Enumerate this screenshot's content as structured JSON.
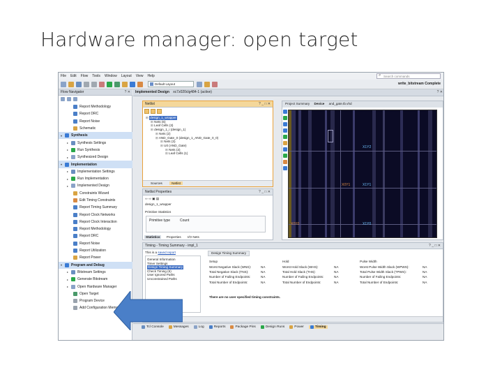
{
  "slide_title": "Hardware manager: open target",
  "menu": [
    "File",
    "Edit",
    "Flow",
    "Tools",
    "Window",
    "Layout",
    "View",
    "Help"
  ],
  "search_placeholder": "Search commands",
  "layout_select": "Default Layout",
  "status": "write_bitstream Complete",
  "flow_nav": {
    "title": "Flow Navigator",
    "items": [
      {
        "label": "Report Methodology",
        "indent": 2,
        "icon": "report-icon",
        "color": "#4a7fc8"
      },
      {
        "label": "Report DRC",
        "indent": 2,
        "icon": "report-icon",
        "color": "#4a7fc8"
      },
      {
        "label": "Report Noise",
        "indent": 2,
        "icon": "report-icon",
        "color": "#4a7fc8"
      },
      {
        "label": "Schematic",
        "indent": 2,
        "icon": "schematic-icon",
        "color": "#d9a443"
      },
      {
        "label": "Synthesis",
        "indent": 0,
        "icon": "synthesis-icon",
        "color": "#3a7bd5",
        "section": true
      },
      {
        "label": "Synthesis Settings",
        "indent": 1,
        "icon": "gear-icon",
        "color": "#6a8fc0"
      },
      {
        "label": "Run Synthesis",
        "indent": 1,
        "icon": "run-icon",
        "color": "#2aa84a"
      },
      {
        "label": "Synthesized Design",
        "indent": 1,
        "icon": "design-icon",
        "color": "#8aa3c8"
      },
      {
        "label": "Implementation",
        "indent": 0,
        "icon": "implementation-icon",
        "color": "#3a7bd5",
        "section": true
      },
      {
        "label": "Implementation Settings",
        "indent": 1,
        "icon": "gear-icon",
        "color": "#6a8fc0"
      },
      {
        "label": "Run Implementation",
        "indent": 1,
        "icon": "run-icon",
        "color": "#2aa84a"
      },
      {
        "label": "Implemented Design",
        "indent": 1,
        "icon": "design-icon",
        "color": "#8aa3c8"
      },
      {
        "label": "Constraints Wizard",
        "indent": 2,
        "icon": "wizard-icon",
        "color": "#d9a443"
      },
      {
        "label": "Edit Timing Constraints",
        "indent": 2,
        "icon": "clock-icon",
        "color": "#d98a43"
      },
      {
        "label": "Report Timing Summary",
        "indent": 2,
        "icon": "clock-icon",
        "color": "#4a7fc8"
      },
      {
        "label": "Report Clock Networks",
        "indent": 2,
        "icon": "report-icon",
        "color": "#4a7fc8"
      },
      {
        "label": "Report Clock Interaction",
        "indent": 2,
        "icon": "report-icon",
        "color": "#4a7fc8"
      },
      {
        "label": "Report Methodology",
        "indent": 2,
        "icon": "report-icon",
        "color": "#4a7fc8"
      },
      {
        "label": "Report DRC",
        "indent": 2,
        "icon": "report-icon",
        "color": "#4a7fc8"
      },
      {
        "label": "Report Noise",
        "indent": 2,
        "icon": "report-icon",
        "color": "#4a7fc8"
      },
      {
        "label": "Report Utilization",
        "indent": 2,
        "icon": "report-icon",
        "color": "#4a7fc8"
      },
      {
        "label": "Report Power",
        "indent": 2,
        "icon": "power-icon",
        "color": "#d9a443"
      },
      {
        "label": "Program and Debug",
        "indent": 0,
        "icon": "program-icon",
        "color": "#3a7bd5",
        "section": true
      },
      {
        "label": "Bitstream Settings",
        "indent": 1,
        "icon": "gear-icon",
        "color": "#6a8fc0"
      },
      {
        "label": "Generate Bitstream",
        "indent": 1,
        "icon": "bitstream-icon",
        "color": "#2aa84a"
      },
      {
        "label": "Open Hardware Manager",
        "indent": 1,
        "icon": "hardware-icon",
        "color": "#8aa3c8"
      },
      {
        "label": "Open Target",
        "indent": 2,
        "icon": "target-icon",
        "color": "#4a9a6a"
      },
      {
        "label": "Program Device",
        "indent": 2,
        "icon": "chip-icon",
        "color": "#9aa3ad"
      },
      {
        "label": "Add Configuration Memory D",
        "indent": 2,
        "icon": "memory-icon",
        "color": "#9aa3ad"
      }
    ]
  },
  "impl_header": {
    "title": "Implemented Design",
    "part": "xc7z020clg484-1",
    "state": "(active)"
  },
  "netlist": {
    "title": "Netlist",
    "tree": [
      {
        "label": "design_1_wrapper",
        "indent": 0,
        "selected": true
      },
      {
        "label": "Nets (6)",
        "indent": 1
      },
      {
        "label": "Leaf Cells (3)",
        "indent": 1
      },
      {
        "label": "design_1_i (design_1)",
        "indent": 1
      },
      {
        "label": "Nets (2)",
        "indent": 2
      },
      {
        "label": "AND_Gate_0 (design_1_AND_Gate_0_0)",
        "indent": 2
      },
      {
        "label": "Nets (3)",
        "indent": 3
      },
      {
        "label": "U0 (AND_Gate)",
        "indent": 3
      },
      {
        "label": "Nets (3)",
        "indent": 4
      },
      {
        "label": "Leaf Cells (1)",
        "indent": 4
      }
    ],
    "tabs": [
      "Sources",
      "Netlist"
    ]
  },
  "netlist_props": {
    "title": "Netlist Properties",
    "object": "design_1_wrapper",
    "section": "Primitive Statistics",
    "col1": "Primitive type",
    "col2": "Count",
    "tabs": [
      "Statistics",
      "Properties",
      "I/O Nets"
    ]
  },
  "device_tabs": [
    "Project Summary",
    "Device",
    "and_gate.tb.vhd"
  ],
  "clock_regions": [
    "X1Y2",
    "X0Y1",
    "X1Y1",
    "X0Y0",
    "X1Y0"
  ],
  "timing": {
    "title": "Timing - Timing Summary - impl_1",
    "saved_note": "This is a",
    "saved_link": "saved report",
    "tree": [
      "General Information",
      "Timer Settings",
      "Design Timing Summary",
      "Check Timing (6)",
      "User Ignored Paths",
      "Unconstrained Paths"
    ],
    "tree_selected": 2,
    "tab": "Design Timing Summary",
    "setup": {
      "title": "Setup",
      "rows": [
        [
          "Worst Negative Slack (WNS):",
          "NA"
        ],
        [
          "Total Negative Slack (TNS):",
          "NA"
        ],
        [
          "Number of Failing Endpoints:",
          "NA"
        ],
        [
          "Total Number of Endpoints:",
          "NA"
        ]
      ]
    },
    "hold": {
      "title": "Hold",
      "rows": [
        [
          "Worst Hold Slack (WHS):",
          "NA"
        ],
        [
          "Total Hold Slack (THS):",
          "NA"
        ],
        [
          "Number of Failing Endpoints:",
          "NA"
        ],
        [
          "Total Number of Endpoints:",
          "NA"
        ]
      ]
    },
    "pulse": {
      "title": "Pulse Width",
      "rows": [
        [
          "Worst Pulse Width Slack (WPWS):",
          "NA"
        ],
        [
          "Total Pulse Width Slack (TPWS):",
          "NA"
        ],
        [
          "Number of Failing Endpoints:",
          "NA"
        ],
        [
          "Total Number of Endpoints:",
          "NA"
        ]
      ]
    },
    "message": "There are no user specified timing constraints.",
    "bottom": "Timing Summary - impl_1"
  },
  "bottom_tabs": [
    {
      "label": "Tcl Console",
      "color": "#6a8fc0"
    },
    {
      "label": "Messages",
      "color": "#d9a443"
    },
    {
      "label": "Log",
      "color": "#8aa3c8"
    },
    {
      "label": "Reports",
      "color": "#4a7fc8"
    },
    {
      "label": "Package Pins",
      "color": "#d98a43"
    },
    {
      "label": "Design Runs",
      "color": "#2aa84a"
    },
    {
      "label": "Power",
      "color": "#d9a443"
    },
    {
      "label": "Timing",
      "color": "#3a7bd5",
      "active": true
    }
  ],
  "arrow_color": "#4a7fc8"
}
